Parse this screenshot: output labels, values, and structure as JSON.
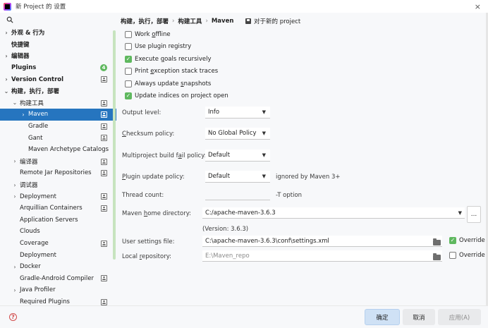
{
  "window": {
    "title": "新 Project 的 设置",
    "close_glyph": "×"
  },
  "sidebar": {
    "items": [
      {
        "label": "外观 & 行为",
        "chevron": "›",
        "bold": true,
        "indent": 0,
        "icon": "",
        "selected": false
      },
      {
        "label": "快捷键",
        "chevron": "",
        "bold": true,
        "indent": 0,
        "icon": "",
        "selected": false
      },
      {
        "label": "编辑器",
        "chevron": "›",
        "bold": true,
        "indent": 0,
        "icon": "",
        "selected": false
      },
      {
        "label": "Plugins",
        "chevron": "",
        "bold": true,
        "indent": 0,
        "icon": "badge",
        "badge": "4",
        "selected": false
      },
      {
        "label": "Version Control",
        "chevron": "›",
        "bold": true,
        "indent": 0,
        "icon": "project",
        "selected": false
      },
      {
        "label": "构建，执行，部署",
        "chevron": "⌄",
        "bold": true,
        "indent": 0,
        "icon": "",
        "selected": false
      },
      {
        "label": "构建工具",
        "chevron": "⌄",
        "bold": false,
        "indent": 1,
        "icon": "project",
        "selected": false
      },
      {
        "label": "Maven",
        "chevron": "›",
        "bold": false,
        "indent": 2,
        "icon": "project",
        "selected": true
      },
      {
        "label": "Gradle",
        "chevron": "",
        "bold": false,
        "indent": 2,
        "icon": "project",
        "selected": false
      },
      {
        "label": "Gant",
        "chevron": "",
        "bold": false,
        "indent": 2,
        "icon": "project",
        "selected": false
      },
      {
        "label": "Maven Archetype Catalogs",
        "chevron": "",
        "bold": false,
        "indent": 2,
        "icon": "",
        "selected": false
      },
      {
        "label": "编译器",
        "chevron": "›",
        "bold": false,
        "indent": 1,
        "icon": "project",
        "selected": false
      },
      {
        "label": "Remote Jar Repositories",
        "chevron": "",
        "bold": false,
        "indent": 1,
        "icon": "project",
        "selected": false
      },
      {
        "label": "调试器",
        "chevron": "›",
        "bold": false,
        "indent": 1,
        "icon": "",
        "selected": false
      },
      {
        "label": "Deployment",
        "chevron": "›",
        "bold": false,
        "indent": 1,
        "icon": "project",
        "selected": false
      },
      {
        "label": "Arquillian Containers",
        "chevron": "",
        "bold": false,
        "indent": 1,
        "icon": "project",
        "selected": false
      },
      {
        "label": "Application Servers",
        "chevron": "",
        "bold": false,
        "indent": 1,
        "icon": "",
        "selected": false
      },
      {
        "label": "Clouds",
        "chevron": "",
        "bold": false,
        "indent": 1,
        "icon": "",
        "selected": false
      },
      {
        "label": "Coverage",
        "chevron": "",
        "bold": false,
        "indent": 1,
        "icon": "project",
        "selected": false
      },
      {
        "label": "Deployment",
        "chevron": "",
        "bold": false,
        "indent": 1,
        "icon": "",
        "selected": false
      },
      {
        "label": "Docker",
        "chevron": "›",
        "bold": false,
        "indent": 1,
        "icon": "",
        "selected": false
      },
      {
        "label": "Gradle-Android Compiler",
        "chevron": "",
        "bold": false,
        "indent": 1,
        "icon": "project",
        "selected": false
      },
      {
        "label": "Java Profiler",
        "chevron": "›",
        "bold": false,
        "indent": 1,
        "icon": "",
        "selected": false
      },
      {
        "label": "Required Plugins",
        "chevron": "",
        "bold": false,
        "indent": 1,
        "icon": "project",
        "selected": false
      }
    ]
  },
  "breadcrumb": {
    "items": [
      "构建，执行，部署",
      "构建工具",
      "Maven"
    ],
    "separator": "›",
    "project_scope": "对于新的 project"
  },
  "checkboxes": [
    {
      "pre": "Work ",
      "u": "o",
      "post": "ffline",
      "checked": false
    },
    {
      "pre": "Use plugin registry",
      "u": "",
      "post": "",
      "checked": false
    },
    {
      "pre": "Execute ",
      "u": "g",
      "post": "oals recursively",
      "checked": true
    },
    {
      "pre": "Print ",
      "u": "e",
      "post": "xception stack traces",
      "checked": false
    },
    {
      "pre": "Always update ",
      "u": "s",
      "post": "napshots",
      "checked": false
    },
    {
      "pre": "Update indices on project open",
      "u": "",
      "post": "",
      "checked": true
    }
  ],
  "settings": {
    "output_level": {
      "label": "Output level:",
      "value": "Info"
    },
    "checksum_policy": {
      "label_pre": "",
      "label_u": "C",
      "label_post": "hecksum policy:",
      "value": "No Global Policy"
    },
    "multiproject_policy": {
      "label_pre": "Multiproject build f",
      "label_u": "a",
      "label_post": "il policy:",
      "value": "Default"
    },
    "plugin_update_policy": {
      "label_pre": "",
      "label_u": "P",
      "label_post": "lugin update policy:",
      "value": "Default",
      "hint": "ignored by Maven 3+"
    },
    "thread_count": {
      "label": "Thread count:",
      "value": "",
      "hint": "-T option"
    },
    "maven_home": {
      "label_pre": "Maven ",
      "label_u": "h",
      "label_post": "ome directory:",
      "value": "C:/apache-maven-3.6.3",
      "version": "(Version: 3.6.3)",
      "browse": "..."
    },
    "user_settings": {
      "label": "User settings file:",
      "value": "C:\\apache-maven-3.6.3\\conf\\settings.xml",
      "override_label": "Override",
      "override_checked": true
    },
    "local_repository": {
      "label_pre": "Local ",
      "label_u": "r",
      "label_post": "epository:",
      "value": "E:\\Maven_repo",
      "override_label": "Override",
      "override_checked": false
    }
  },
  "footer": {
    "ok_label": "确定",
    "cancel_label": "取消",
    "apply_label": "应用(A)",
    "help_glyph": "?"
  },
  "colors": {
    "accent": "#2675bf",
    "check_green": "#5fb85f",
    "ok_button": "#cfe1f5"
  },
  "icons": {
    "dropdown_arrow": "▼",
    "check": "✓"
  }
}
